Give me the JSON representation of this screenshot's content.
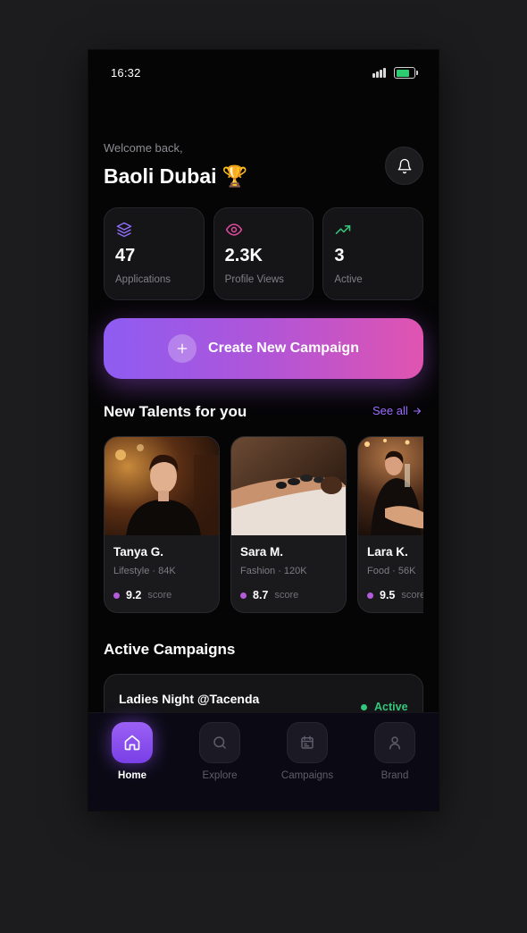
{
  "status_bar": {
    "time": "16:32"
  },
  "header": {
    "greeting": "Welcome back,",
    "user_name": "Baoli Dubai 🏆",
    "notification_icon": "bell-icon"
  },
  "stats": [
    {
      "icon": "layers-icon",
      "value": "47",
      "label": "Applications",
      "color": "#8e6cf5"
    },
    {
      "icon": "eye-icon",
      "value": "2.3K",
      "label": "Profile Views",
      "color": "#e04b9e"
    },
    {
      "icon": "trending-up-icon",
      "value": "3",
      "label": "Active",
      "color": "#34c77b"
    }
  ],
  "cta": {
    "label": "Create New Campaign",
    "icon": "plus-icon"
  },
  "talents_section": {
    "title": "New Talents for you",
    "see_all": "See all",
    "items": [
      {
        "name": "Tanya G.",
        "meta": "Lifestyle · 84K",
        "score": "9.2",
        "score_label": "score"
      },
      {
        "name": "Sara M.",
        "meta": "Fashion · 120K",
        "score": "8.7",
        "score_label": "score"
      },
      {
        "name": "Lara K.",
        "meta": "Food · 56K",
        "score": "9.5",
        "score_label": "score"
      }
    ]
  },
  "campaigns_section": {
    "title": "Active Campaigns",
    "items": [
      {
        "name": "Ladies Night @Tacenda",
        "status": "Active"
      }
    ]
  },
  "tab_bar": [
    {
      "label": "Home",
      "icon": "home-icon",
      "active": true
    },
    {
      "label": "Explore",
      "icon": "search-icon",
      "active": false
    },
    {
      "label": "Campaigns",
      "icon": "calendar-icon",
      "active": false
    },
    {
      "label": "Brand",
      "icon": "user-icon",
      "active": false
    }
  ],
  "colors": {
    "accent": "#9b6dff",
    "gradient_start": "#8e5cf2",
    "gradient_end": "#e054b0",
    "active_green": "#34c77b",
    "score_dot": "#b35bd8"
  }
}
